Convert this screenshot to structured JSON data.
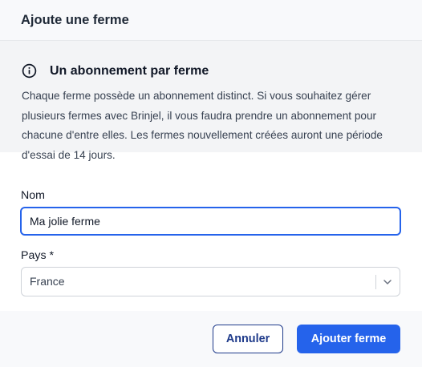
{
  "dialog": {
    "title": "Ajoute une ferme"
  },
  "info": {
    "icon": "info-icon",
    "title": "Un abonnement par ferme",
    "text": "Chaque ferme possède un abonnement distinct. Si vous souhaitez gérer plusieurs fermes avec Brinjel, il vous faudra prendre un abonnement pour chacune d'entre elles. Les fermes nouvellement créées auront une période d'essai de 14 jours."
  },
  "form": {
    "name_label": "Nom",
    "name_value": "Ma jolie ferme",
    "country_label": "Pays *",
    "country_value": "France",
    "country_icon": "chevron-down-icon"
  },
  "actions": {
    "cancel_label": "Annuler",
    "submit_label": "Ajouter ferme"
  },
  "colors": {
    "primary": "#2563eb",
    "cancel_border": "#1e3a8a",
    "info_background": "#f3f4f6"
  }
}
